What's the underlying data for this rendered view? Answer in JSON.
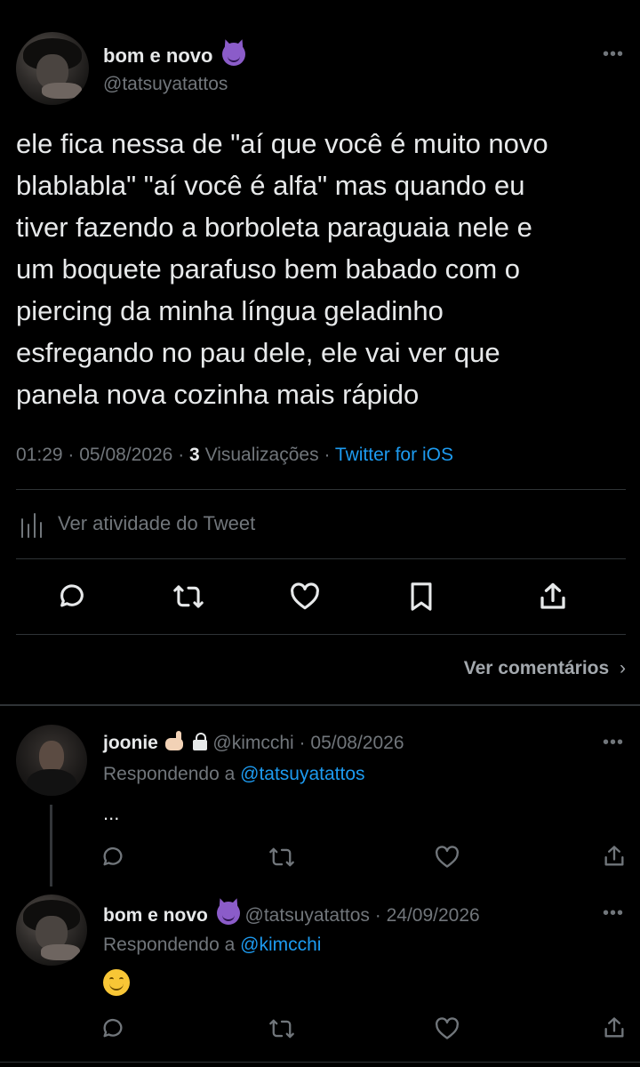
{
  "main_tweet": {
    "display_name": "bom e novo",
    "handle": "@tatsuyatattos",
    "text": "ele fica nessa de \"aí que você é muito novo\nblablabla\" \"aí você é alfa\" mas quando eu\ntiver fazendo a borboleta paraguaia nele e\num boquete parafuso bem babado com o\npiercing da minha língua geladinho\nesfregando no pau dele, ele vai ver que\npanela nova cozinha mais rápido",
    "time": "01:29",
    "date": "05/08/2026",
    "views_count": "3",
    "views_label": "Visualizações",
    "source": "Twitter for iOS",
    "activity_label": "Ver atividade do Tweet",
    "more_comments": "Ver comentários",
    "name_emoji": "smiling-devil-emoji"
  },
  "replies": [
    {
      "display_name": "joonie",
      "handle": "@kimcchi",
      "date": "05/08/2026",
      "replying_prefix": "Respondendo a",
      "replying_to": "@tatsuyatattos",
      "text": "...",
      "name_emojis": [
        "hand-emoji",
        "lock-emoji"
      ]
    },
    {
      "display_name": "bom e novo",
      "handle": "@tatsuyatattos",
      "date": "24/09/2026",
      "replying_prefix": "Respondendo a",
      "replying_to": "@kimcchi",
      "text_emoji": "smiling-face-emoji",
      "name_emoji": "smiling-devil-emoji"
    }
  ],
  "colors": {
    "background": "#000000",
    "text": "#e7e9ea",
    "muted": "#71767b",
    "link": "#1d9bf0",
    "divider": "#2f3336"
  },
  "separator": "·"
}
